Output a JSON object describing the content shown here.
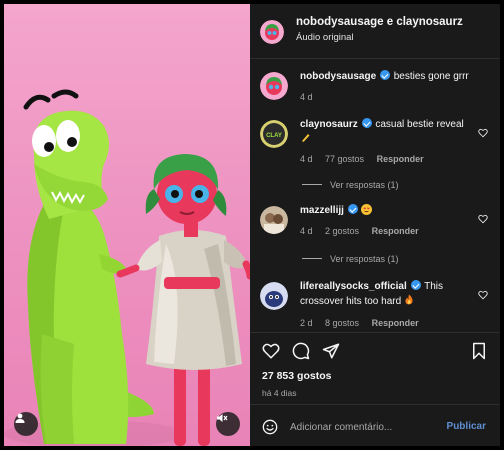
{
  "post": {
    "author_names": "nobodysausage e claynosaurz",
    "audio_label": "Áudio original"
  },
  "comments": [
    {
      "username": "nobodysausage",
      "verified": true,
      "text": "besties gone grrr",
      "time": "4 d"
    },
    {
      "username": "claynosaurz",
      "verified": true,
      "text": "casual bestie reveal",
      "time": "4 d",
      "likes": "77 gostos",
      "reply_label": "Responder",
      "view_replies": "Ver respostas (1)"
    },
    {
      "username": "mazzellijj",
      "verified": true,
      "text": "",
      "time": "4 d",
      "likes": "2 gostos",
      "reply_label": "Responder",
      "view_replies": "Ver respostas (1)"
    },
    {
      "username": "lifereallysocks_official",
      "verified": true,
      "text": "This crossover hits too hard",
      "time": "2 d",
      "likes": "8 gostos",
      "reply_label": "Responder"
    }
  ],
  "footer": {
    "likes_count": "27 853 gostos",
    "date": "há 4 dias",
    "comment_placeholder": "Adicionar comentário...",
    "publish_label": "Publicar"
  },
  "icons": {
    "like": "heart-icon",
    "comment": "comment-icon",
    "share": "send-icon",
    "save": "bookmark-icon",
    "emoji": "emoji-icon",
    "user": "user-icon",
    "mute": "muted-speaker-icon"
  },
  "colors": {
    "background": "#000000",
    "panel": "#1a1a1a",
    "verified": "#3897f0",
    "publish": "#5f8fd0",
    "media_pink": "#f4a6cd"
  }
}
